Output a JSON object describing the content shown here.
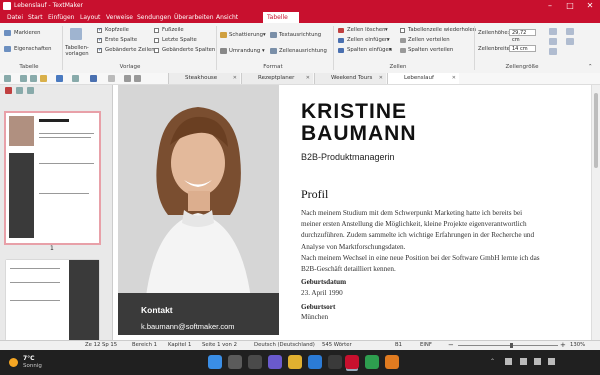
{
  "window": {
    "title": "Lebenslauf - TextMaker"
  },
  "menu": [
    "Datei",
    "Start",
    "Einfügen",
    "Layout",
    "Verweise",
    "Sendungen",
    "Überarbeiten",
    "Ansicht",
    "Tabelle"
  ],
  "ribbon": {
    "tabelle_group": {
      "markieren": "Markieren",
      "eigenschaften": "Eigenschaften",
      "label": "Tabelle"
    },
    "vorlage_group": {
      "tabellenvorlagen": [
        "Tabellen-",
        "vorlagen"
      ],
      "kopfzeile": "Kopfzeile",
      "erste_spalte": "Erste Spalte",
      "gebaenderte_zeilen": "Gebänderte Zeilen",
      "fusszeile": "Fußzeile",
      "letzte_spalte": "Letzte Spalte",
      "gebaenderte_spalten": "Gebänderte Spalten",
      "label": "Vorlage"
    },
    "format_group": {
      "schattierung": "Schattierung",
      "umrandung": "Umrandung",
      "textausrichtung": "Textausrichtung",
      "zellenausrichtung": "Zellenausrichtung",
      "label": "Format"
    },
    "zellen_group": {
      "zellen_loeschen": "Zellen löschen",
      "zellen_einfuegen": "Zellen einfügen",
      "spalten_einfuegen": "Spalten einfügen",
      "tabellenzeile_wiederholen": "Tabellenzeile wiederholen",
      "zellen_verteilen": "Zellen verteilen",
      "spalten_verteilen": "Spalten verteilen",
      "label": "Zellen"
    },
    "zellengroesse_group": {
      "zeilenhoehe_label": "Zeilenhöhe:",
      "zeilenhoehe_value": "29,72 cm",
      "zellenbreite_label": "Zellenbreite:",
      "zellenbreite_value": "14 cm",
      "label": "Zellengröße"
    }
  },
  "doc_tabs": [
    "Steakhouse",
    "Rezeptplaner",
    "Weekend Tours",
    "Lebenslauf"
  ],
  "sidebar": {
    "page_number": "1"
  },
  "document": {
    "name_line1": "KRISTINE",
    "name_line2": "BAUMANN",
    "job_title": "B2B-Produktmanagerin",
    "profil_heading": "Profil",
    "profil_p1": [
      "Nach meinem Studium mit dem Schwerpunkt Marketing hatte ich bereits bei",
      "meiner ersten Anstellung die Möglichkeit, kleine Projekte eigenverantwortlich",
      "durchzuführen. Zudem sammelte ich wichtige Erfahrungen in der Recherche und",
      "Analyse von Marktforschungsdaten."
    ],
    "profil_p2": [
      "Nach meinem Wechsel in eine neue Position bei der Software GmbH lernte ich das",
      "B2B-Geschäft detailliert kennen."
    ],
    "geburtsdatum_label": "Geburtsdatum",
    "geburtsdatum_value": "23. April 1990",
    "geburtsort_label": "Geburtsort",
    "geburtsort_value": "München",
    "kontakt_heading": "Kontakt",
    "kontakt_email": "k.baumann@softmaker.com"
  },
  "statusbar": {
    "position": "Ze 12 Sp 15",
    "bereich": "Bereich 1",
    "kapitel": "Kapitel 1",
    "seite": "Seite 1 von 2",
    "sprache": "Deutsch (Deutschland)",
    "woerter": "545 Wörter",
    "b1": "B1",
    "modus": "EINF",
    "zoom": "130%"
  },
  "taskbar": {
    "temperature": "7°C",
    "weather": "Sonnig"
  },
  "colors": {
    "accent": "#c8102e",
    "taskbar": "#202020"
  }
}
